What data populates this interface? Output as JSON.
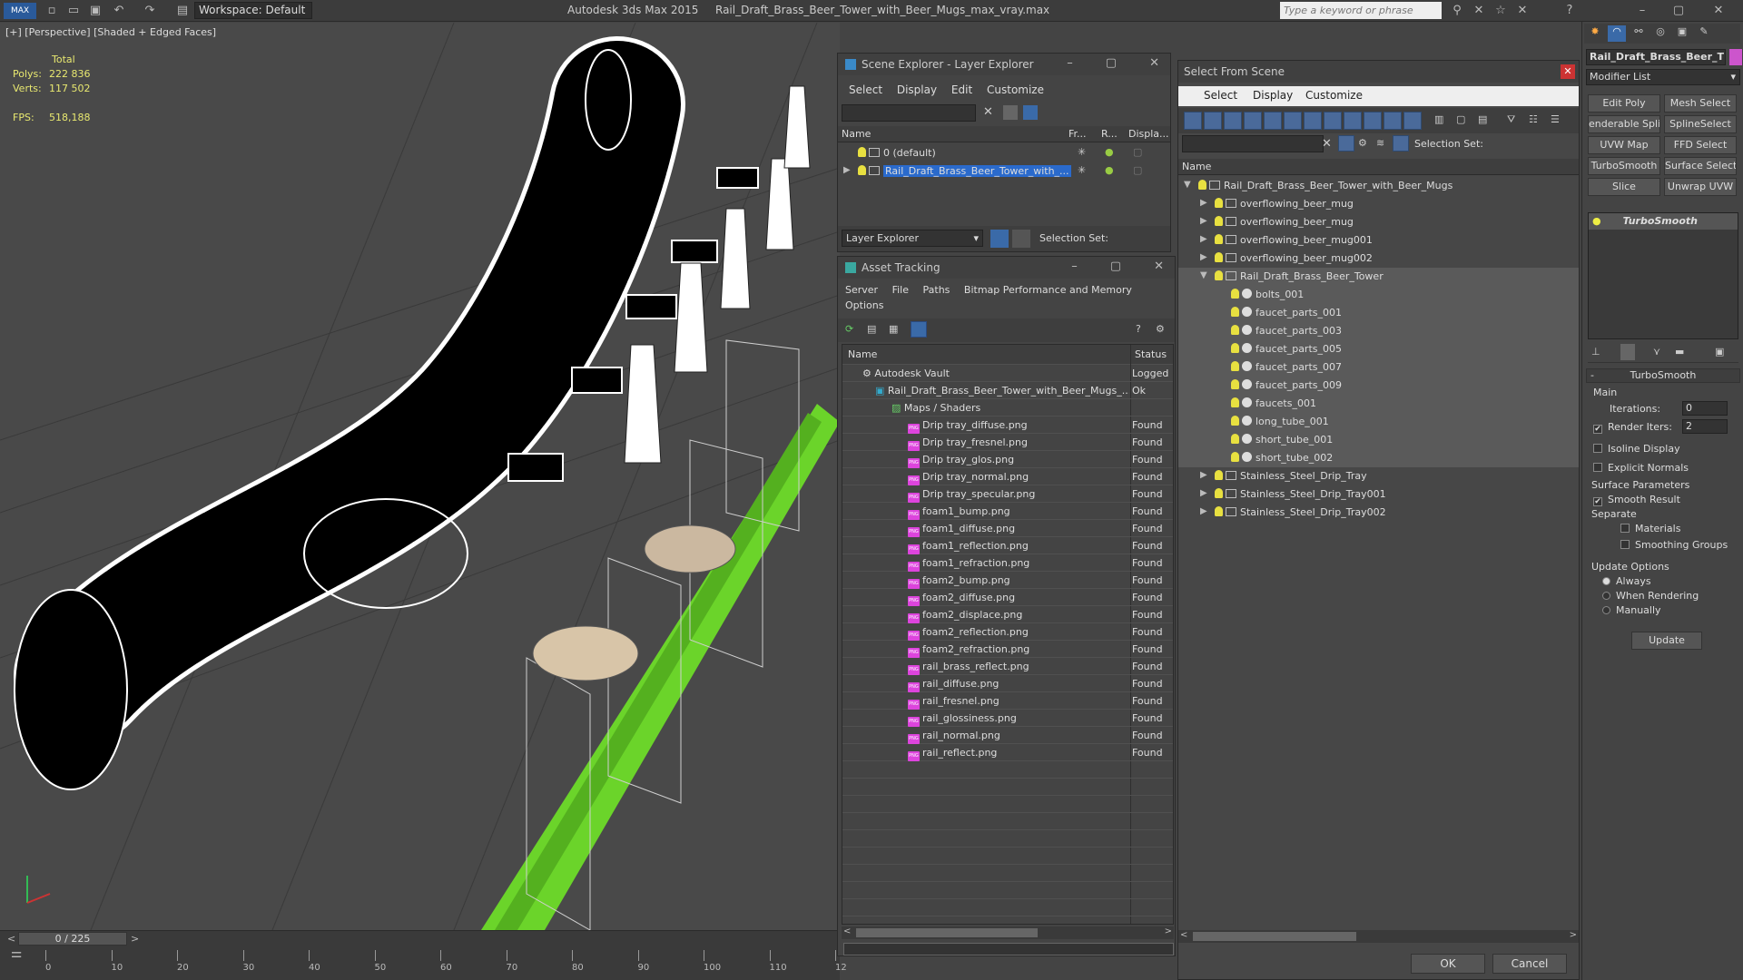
{
  "app": {
    "title": "Autodesk 3ds Max  2015",
    "file": "Rail_Draft_Brass_Beer_Tower_with_Beer_Mugs_max_vray.max",
    "workspace": "Workspace: Default",
    "search_placeholder": "Type a keyword or phrase"
  },
  "viewport": {
    "label": "[+] [Perspective] [Shaded + Edged Faces]",
    "stats_header": "Total",
    "polys_label": "Polys:",
    "polys": "222 836",
    "verts_label": "Verts:",
    "verts": "117 502",
    "fps_label": "FPS:",
    "fps": "518,188",
    "timeline": "0 / 225",
    "ticks": [
      "0",
      "10",
      "20",
      "30",
      "40",
      "50",
      "60",
      "70",
      "80",
      "90",
      "100",
      "110",
      "12"
    ]
  },
  "scene_explorer": {
    "title": "Scene Explorer - Layer Explorer",
    "menu": [
      "Select",
      "Display",
      "Edit",
      "Customize"
    ],
    "columns": [
      "Name",
      "Fr...",
      "R...",
      "Displa..."
    ],
    "rows": [
      {
        "name": "0 (default)",
        "selected": false
      },
      {
        "name": "Rail_Draft_Brass_Beer_Tower_with_...",
        "selected": true
      }
    ],
    "footer_combo": "Layer Explorer",
    "selection_set": "Selection Set:"
  },
  "asset_tracking": {
    "title": "Asset Tracking",
    "menu": [
      "Server",
      "File",
      "Paths",
      "Bitmap Performance and Memory"
    ],
    "menu2": [
      "Options"
    ],
    "columns": [
      "Name",
      "Status"
    ],
    "vault": {
      "name": "Autodesk Vault",
      "status": "Logged"
    },
    "file": {
      "name": "Rail_Draft_Brass_Beer_Tower_with_Beer_Mugs_...",
      "status": "Ok"
    },
    "maps_folder": "Maps / Shaders",
    "assets": [
      {
        "name": "Drip tray_diffuse.png",
        "status": "Found"
      },
      {
        "name": "Drip tray_fresnel.png",
        "status": "Found"
      },
      {
        "name": "Drip tray_glos.png",
        "status": "Found"
      },
      {
        "name": "Drip tray_normal.png",
        "status": "Found"
      },
      {
        "name": "Drip tray_specular.png",
        "status": "Found"
      },
      {
        "name": "foam1_bump.png",
        "status": "Found"
      },
      {
        "name": "foam1_diffuse.png",
        "status": "Found"
      },
      {
        "name": "foam1_reflection.png",
        "status": "Found"
      },
      {
        "name": "foam1_refraction.png",
        "status": "Found"
      },
      {
        "name": "foam2_bump.png",
        "status": "Found"
      },
      {
        "name": "foam2_diffuse.png",
        "status": "Found"
      },
      {
        "name": "foam2_displace.png",
        "status": "Found"
      },
      {
        "name": "foam2_reflection.png",
        "status": "Found"
      },
      {
        "name": "foam2_refraction.png",
        "status": "Found"
      },
      {
        "name": "rail_brass_reflect.png",
        "status": "Found"
      },
      {
        "name": "rail_diffuse.png",
        "status": "Found"
      },
      {
        "name": "rail_fresnel.png",
        "status": "Found"
      },
      {
        "name": "rail_glossiness.png",
        "status": "Found"
      },
      {
        "name": "rail_normal.png",
        "status": "Found"
      },
      {
        "name": "rail_reflect.png",
        "status": "Found"
      }
    ]
  },
  "select_from_scene": {
    "title": "Select From Scene",
    "menu": [
      "Select",
      "Display",
      "Customize"
    ],
    "selection_set": "Selection Set:",
    "column": "Name",
    "tree": [
      {
        "name": "Rail_Draft_Brass_Beer_Tower_with_Beer_Mugs",
        "level": 0,
        "expand": "open",
        "type": "layer"
      },
      {
        "name": "overflowing_beer_mug",
        "level": 1,
        "expand": "closed",
        "type": "layer"
      },
      {
        "name": "overflowing_beer_mug",
        "level": 1,
        "expand": "closed",
        "type": "layer"
      },
      {
        "name": "overflowing_beer_mug001",
        "level": 1,
        "expand": "closed",
        "type": "layer"
      },
      {
        "name": "overflowing_beer_mug002",
        "level": 1,
        "expand": "closed",
        "type": "layer"
      },
      {
        "name": "Rail_Draft_Brass_Beer_Tower",
        "level": 1,
        "expand": "open",
        "type": "layer"
      },
      {
        "name": "bolts_001",
        "level": 2,
        "expand": "none",
        "type": "object"
      },
      {
        "name": "faucet_parts_001",
        "level": 2,
        "expand": "none",
        "type": "object"
      },
      {
        "name": "faucet_parts_003",
        "level": 2,
        "expand": "none",
        "type": "object"
      },
      {
        "name": "faucet_parts_005",
        "level": 2,
        "expand": "none",
        "type": "object"
      },
      {
        "name": "faucet_parts_007",
        "level": 2,
        "expand": "none",
        "type": "object"
      },
      {
        "name": "faucet_parts_009",
        "level": 2,
        "expand": "none",
        "type": "object"
      },
      {
        "name": "faucets_001",
        "level": 2,
        "expand": "none",
        "type": "object"
      },
      {
        "name": "long_tube_001",
        "level": 2,
        "expand": "none",
        "type": "object"
      },
      {
        "name": "short_tube_001",
        "level": 2,
        "expand": "none",
        "type": "object"
      },
      {
        "name": "short_tube_002",
        "level": 2,
        "expand": "none",
        "type": "object"
      },
      {
        "name": "Stainless_Steel_Drip_Tray",
        "level": 1,
        "expand": "closed",
        "type": "layer"
      },
      {
        "name": "Stainless_Steel_Drip_Tray001",
        "level": 1,
        "expand": "closed",
        "type": "layer"
      },
      {
        "name": "Stainless_Steel_Drip_Tray002",
        "level": 1,
        "expand": "closed",
        "type": "layer"
      }
    ],
    "ok": "OK",
    "cancel": "Cancel"
  },
  "command_panel": {
    "object_name": "Rail_Draft_Brass_Beer_T",
    "modifier_list": "Modifier List",
    "buttons": [
      "Edit Poly",
      "Mesh Select",
      "enderable Splir",
      "SplineSelect",
      "UVW Map",
      "FFD Select",
      "TurboSmooth",
      "Surface Select",
      "Slice",
      "Unwrap UVW"
    ],
    "stack_item": "TurboSmooth",
    "rollout_title": "TurboSmooth",
    "main": "Main",
    "iterations_label": "Iterations:",
    "iterations": "0",
    "render_iters_label": "Render Iters:",
    "render_iters": "2",
    "isoline": "Isoline Display",
    "explicit": "Explicit Normals",
    "surface_params": "Surface Parameters",
    "smooth_result": "Smooth Result",
    "separate": "Separate",
    "materials": "Materials",
    "smoothing_groups": "Smoothing Groups",
    "update_options": "Update Options",
    "always": "Always",
    "when_rendering": "When Rendering",
    "manually": "Manually",
    "update": "Update"
  }
}
